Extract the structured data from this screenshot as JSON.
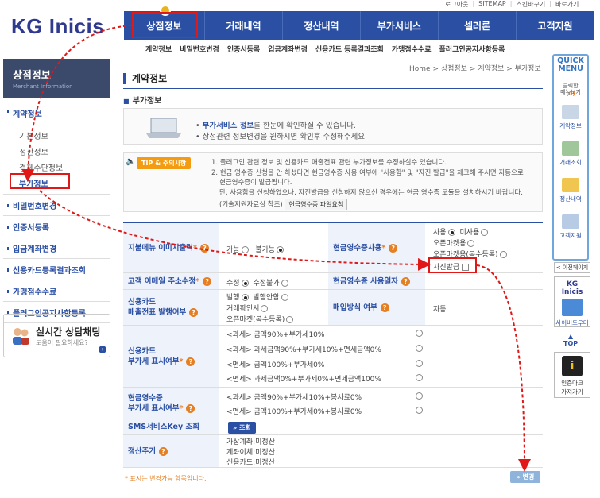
{
  "util": [
    "로그아웃",
    "SITEMAP",
    "스킨바꾸기",
    "바로가기"
  ],
  "logo": "KG Inicis",
  "gnb": [
    "상점정보",
    "거래내역",
    "정산내역",
    "부가서비스",
    "셀러론",
    "고객지원"
  ],
  "snb": [
    "계약정보",
    "비밀번호변경",
    "인증서등록",
    "입금계좌변경",
    "신용카드 등록결과조회",
    "가맹점수수료",
    "플러그인공지사항등록"
  ],
  "sidebar": {
    "title": "상점정보",
    "subtitle": "Merchant Information",
    "menu0": "계약정보",
    "subs": [
      "기본정보",
      "정산정보",
      "결제수단정보",
      "부가정보"
    ],
    "menus": [
      "비밀번호변경",
      "인증서등록",
      "입금계좌변경",
      "신용카드등록결과조회",
      "가맹점수수료",
      "플러그인공지사항등록"
    ],
    "chat_title": "실시간 상담채팅",
    "chat_sub": "도움이 필요하세요?"
  },
  "breadcrumb": "Home > 상점정보 > 계약정보 > 부가정보",
  "page_title": "계약정보",
  "section_title": "부가정보",
  "info": {
    "l1_pre": "• ",
    "l1_hl": "부가서비스 정보",
    "l1_post": "를 한눈에 확인하실 수 있습니다.",
    "l2": "• 상점관련 정보변경을 원하시면 확인후 수정해주세요."
  },
  "tip": {
    "badge": "TIP & 주의사항",
    "lines": [
      "1. 플러그인 관련 정보 및 신용카드 매출전표 관련 부가정보를 수정하실수 있습니다.",
      "2. 현금 영수증 신청을 안 하셨다면 현금영수증 사용 여부에 \"사용함\" 및 \"자진 발급\"을 체크해 주시면 자동으로",
      "현금영수증이 발급됩니다.",
      "단, 사용함을 신청하였으나, 자진발급을 신청하지 않으신 경우에는 현금 영수증 모듈을 설치하시기 바랍니다.",
      "(기술지원자료실 참조)"
    ],
    "btn": "현금영수증 파일요청"
  },
  "form": {
    "r1_label": "지불메뉴 이미지출력",
    "r1_opts": [
      "가능",
      "불가능"
    ],
    "r1_cash_label": "현금영수증사용",
    "r1_cash_opts": [
      "사용",
      "미사용",
      "오픈마켓용",
      "오픈마켓용(복수등록)",
      "자진발급"
    ],
    "r2_label": "고객 이메일 주소수정",
    "r2_opts": [
      "수정",
      "수정불가"
    ],
    "r2_cash_label": "현금영수증 사용일자",
    "r3_label1": "신용카드",
    "r3_label2": "매출전표 발행여부",
    "r3_opts": [
      "발행",
      "발행안함",
      "거래확인서",
      "오픈마켓(복수등록)"
    ],
    "r3_buy_label": "매입방식 여부",
    "r3_buy_val": "자동",
    "r4_label1": "신용카드",
    "r4_label2": "부가세 표시여부",
    "r4_opts": [
      "<과세> 금액90%+부가세10%",
      "<과세> 과세금액90%+부가세10%+면세금액0%",
      "<면세> 금액100%+부가세0%",
      "<면세> 과세금액0%+부가세0%+면세금액100%"
    ],
    "r5_label1": "현금영수증",
    "r5_label2": "부가세 표시여부",
    "r5_opts": [
      "<과세> 금액90%+부가세10%+봉사료0%",
      "<면세> 금액100%+부가세0%+봉사료0%"
    ],
    "r6_label": "SMS서비스Key 조회",
    "r6_btn": "» 조회",
    "r7_label": "정산주기",
    "r7_vals": [
      "가상계좌:미정산",
      "계좌이체:미정산",
      "신용카드:미정산"
    ]
  },
  "foot_note": "* 표시는 변경가능 항목입니다.",
  "change_btn": "» 변경",
  "quick": {
    "title1": "QUICK",
    "title2": "MENU",
    "sub1": "클릭한",
    "sub2": "메뉴보기",
    "count": "(0)",
    "items": [
      "계약정보",
      "거래조회",
      "정산내역",
      "고객지원"
    ],
    "prev": "< 이전페이지",
    "kg": "KG Inicis",
    "cyber": "사이버도우미",
    "top": "TOP",
    "cert1": "인증마크",
    "cert2": "가져가기"
  },
  "colors": {
    "brand": "#2a4fa3",
    "annotation_red": "#e01818",
    "accent": "#e67e22"
  }
}
